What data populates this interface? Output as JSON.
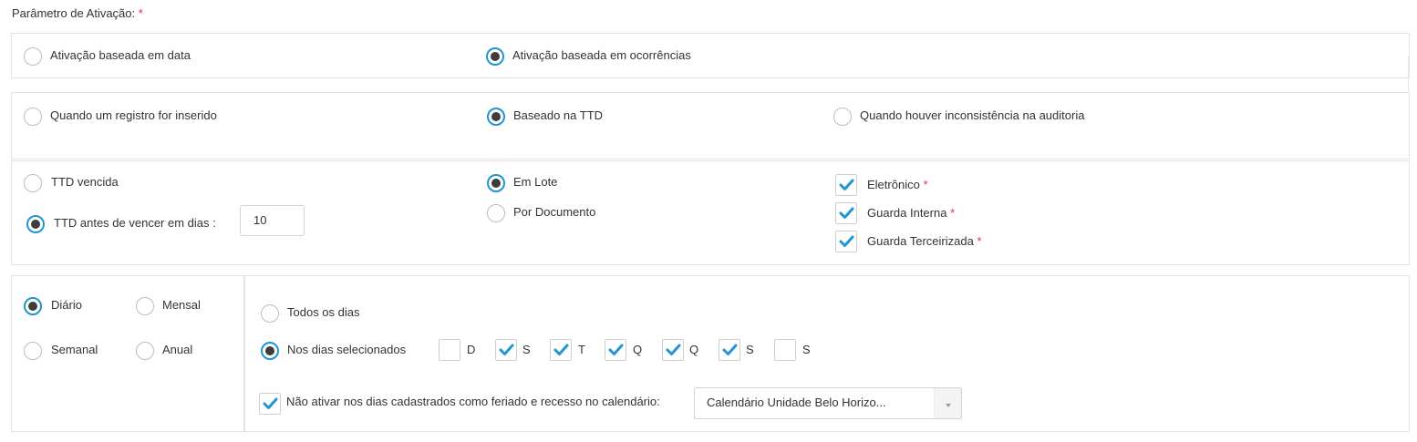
{
  "section": {
    "title": "Parâmetro de Ativação:",
    "required_mark": "*"
  },
  "activation_type": {
    "by_date": "Ativação baseada em data",
    "by_occurrences": "Ativação baseada em ocorrências",
    "selected": "by_occurrences"
  },
  "trigger": {
    "on_insert": "Quando um registro for inserido",
    "ttd_based": "Baseado na TTD",
    "on_audit_inconsistency": "Quando houver inconsistência na auditoria",
    "selected": "ttd_based"
  },
  "ttd": {
    "expired": "TTD vencida",
    "before_expiry": "TTD antes de vencer em dias :",
    "days_value": "10",
    "selected": "before_expiry",
    "batch": "Em Lote",
    "per_document": "Por Documento",
    "mode_selected": "batch",
    "storage": [
      {
        "label": "Eletrônico",
        "checked": true
      },
      {
        "label": "Guarda Interna",
        "checked": true
      },
      {
        "label": "Guarda Terceirizada",
        "checked": true
      }
    ]
  },
  "frequency": {
    "daily": "Diário",
    "monthly": "Mensal",
    "weekly": "Semanal",
    "yearly": "Anual",
    "selected": "daily"
  },
  "days": {
    "all_days": "Todos os dias",
    "selected_days": "Nos dias selecionados",
    "selected": "selected_days",
    "weekdays": [
      {
        "label": "D",
        "checked": false
      },
      {
        "label": "S",
        "checked": true
      },
      {
        "label": "T",
        "checked": true
      },
      {
        "label": "Q",
        "checked": true
      },
      {
        "label": "Q",
        "checked": true
      },
      {
        "label": "S",
        "checked": true
      },
      {
        "label": "S",
        "checked": false
      }
    ],
    "holiday_exclusion_label": "Não ativar nos dias cadastrados como feriado e recesso no calendário:",
    "holiday_exclusion_checked": true,
    "calendar_value": "Calendário Unidade Belo Horizo..."
  },
  "colors": {
    "accent": "#2196d3",
    "radio_dot": "#3d3d3d",
    "required": "#e0323c",
    "border": "#e3e3e3"
  }
}
